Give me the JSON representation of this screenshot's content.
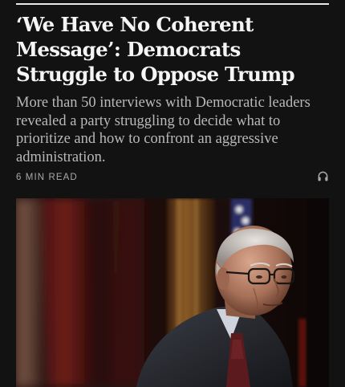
{
  "article": {
    "headline": "‘We Have No Coherent Message’: Democrats Struggle to Oppose Trump",
    "summary": "More than 50 interviews with Democratic leaders revealed a party struggling to decide what to prioritize and how to confront an aggressive administration.",
    "read_time": "6 MIN READ",
    "audio_icon": "headphones-icon"
  },
  "colors": {
    "background": "#121212",
    "headline": "#f5f5f5",
    "summary": "#b9b9b9",
    "meta": "#a9a9a9"
  }
}
